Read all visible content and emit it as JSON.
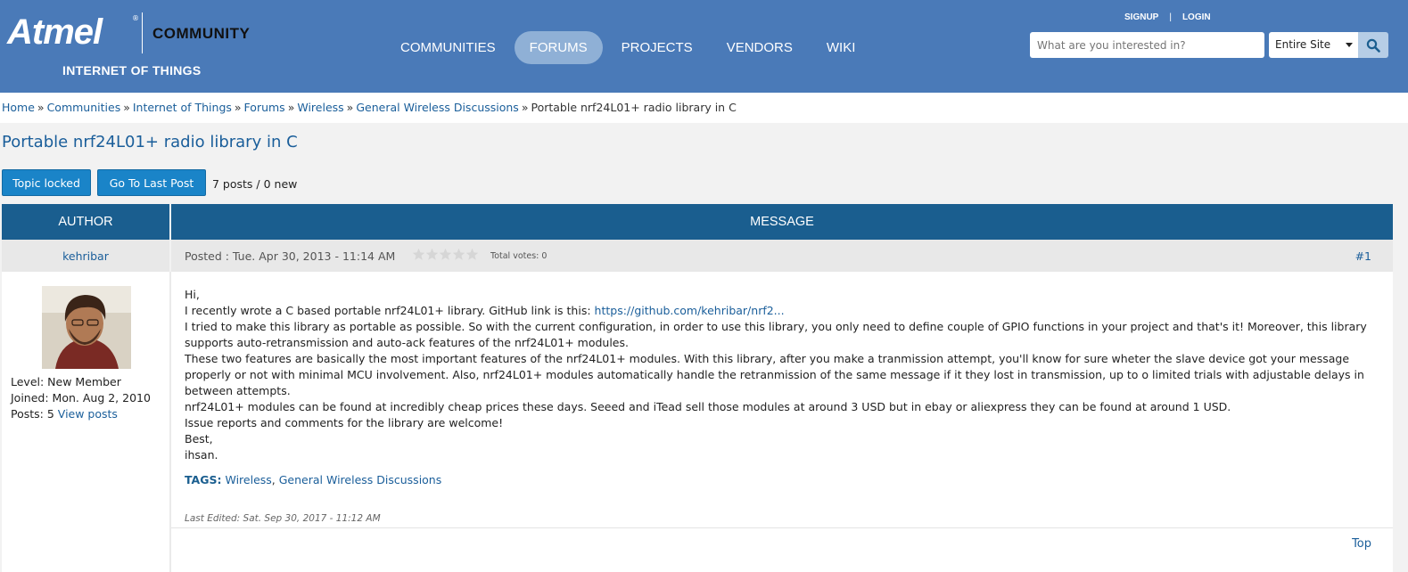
{
  "header": {
    "logo": {
      "brand": "Atmel",
      "registered": "®",
      "community": "COMMUNITY",
      "tagline": "INTERNET OF THINGS"
    },
    "nav": [
      {
        "label": "COMMUNITIES",
        "active": false
      },
      {
        "label": "FORUMS",
        "active": true
      },
      {
        "label": "PROJECTS",
        "active": false
      },
      {
        "label": "VENDORS",
        "active": false
      },
      {
        "label": "WIKI",
        "active": false
      }
    ],
    "top_links": {
      "signup": "SIGNUP",
      "separator": "|",
      "login": "LOGIN"
    },
    "search": {
      "placeholder": "What are you interested in?",
      "scope": "Entire Site"
    }
  },
  "breadcrumb": {
    "items": [
      "Home",
      "Communities",
      "Internet of Things",
      "Forums",
      "Wireless",
      "General Wireless Discussions"
    ],
    "separator": "»",
    "current": "Portable nrf24L01+ radio library in C"
  },
  "topic": {
    "title": "Portable nrf24L01+ radio library in C",
    "locked_label": "Topic locked",
    "last_post_label": "Go To Last Post",
    "post_count": "7 posts / 0 new"
  },
  "table": {
    "author_header": "AUTHOR",
    "message_header": "MESSAGE"
  },
  "post": {
    "author": "kehribar",
    "posted": "Posted : Tue. Apr 30, 2013 - 11:14 AM",
    "rating": 0,
    "votes": "Total votes: 0",
    "number": "#1",
    "member": {
      "level": "Level: New Member",
      "joined": "Joined: Mon. Aug 2, 2010",
      "posts_prefix": "Posts: 5",
      "view_posts": "View posts"
    },
    "lines": {
      "l1": "Hi,",
      "l2_prefix": "I recently wrote a C based portable nrf24L01+ library. GitHub link is this: ",
      "l2_link": "https://github.com/kehribar/nrf2...",
      "l3": "I tried to make this library as portable as possible. So with the current configuration, in order to use this library, you only need to define couple of GPIO functions in your project and that's it! Moreover, this library supports auto-retransmission and auto-ack features of the nrf24L01+ modules.",
      "l4": "These two features are basically the most important features of the nrf24L01+ modules. With this library, after you make a tranmission attempt, you'll know for sure wheter the slave device got your message properly or not with minimal MCU involvement. Also, nrf24L01+ modules automatically handle the retranmission of the same message if it they lost in transmission, up to o limited trials with adjustable delays in between attempts.",
      "l5": "nrf24L01+ modules can be found at incredibly cheap prices these days. Seeed and iTead sell those modules at around 3 USD but in ebay or aliexpress they can be found at around 1 USD.",
      "l6": "Issue reports and comments for the library are welcome!",
      "l7": "Best,",
      "l8": "ihsan."
    },
    "tags_label": "TAGS:",
    "tags": [
      "Wireless",
      "General Wireless Discussions"
    ],
    "tag_separator": ", ",
    "edited": "Last Edited: Sat. Sep 30, 2017 - 11:12 AM",
    "top_link": "Top"
  },
  "colors": {
    "header_bg": "#4a7ab8",
    "nav_active": "#8fb0d6",
    "table_header": "#1a5e8f",
    "button": "#1a84c8",
    "link": "#1a5e9a"
  }
}
